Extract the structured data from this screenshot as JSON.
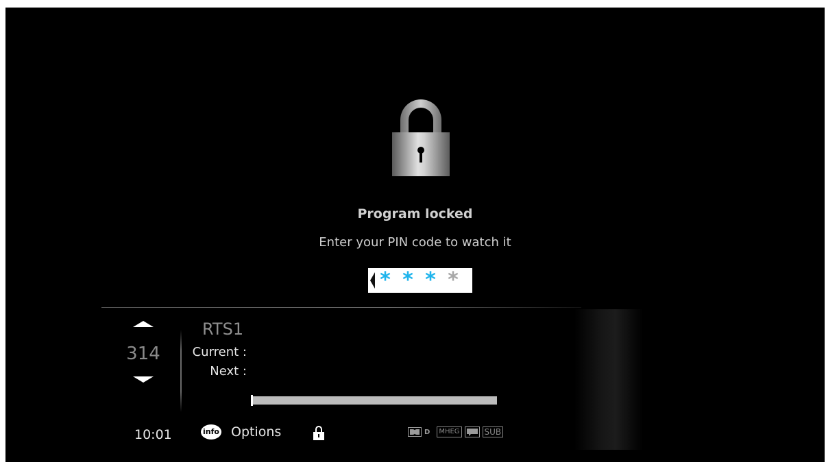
{
  "lock_screen": {
    "title": "Program locked",
    "message": "Enter your PIN code to watch it",
    "pin": {
      "digits": [
        "*",
        "*",
        "*",
        "*"
      ],
      "entered_count": 3,
      "filled_color": "#1fb4ec",
      "empty_color": "#a8a8a8"
    }
  },
  "info_bar": {
    "channel_number": "314",
    "channel_name": "RTS1",
    "current_label": "Current :",
    "next_label": "Next :",
    "progress_fraction": 0.0,
    "clock": "10:01",
    "info_button_label": "info",
    "options_label": "Options",
    "status_icons": {
      "dolby_letter": "D",
      "mheg": "MHEG",
      "sub": "SUB"
    }
  },
  "icons": {
    "lock_big": "padlock-icon",
    "lock_small": "padlock-icon",
    "channel_up": "triangle-up-icon",
    "channel_down": "triangle-down-icon"
  }
}
